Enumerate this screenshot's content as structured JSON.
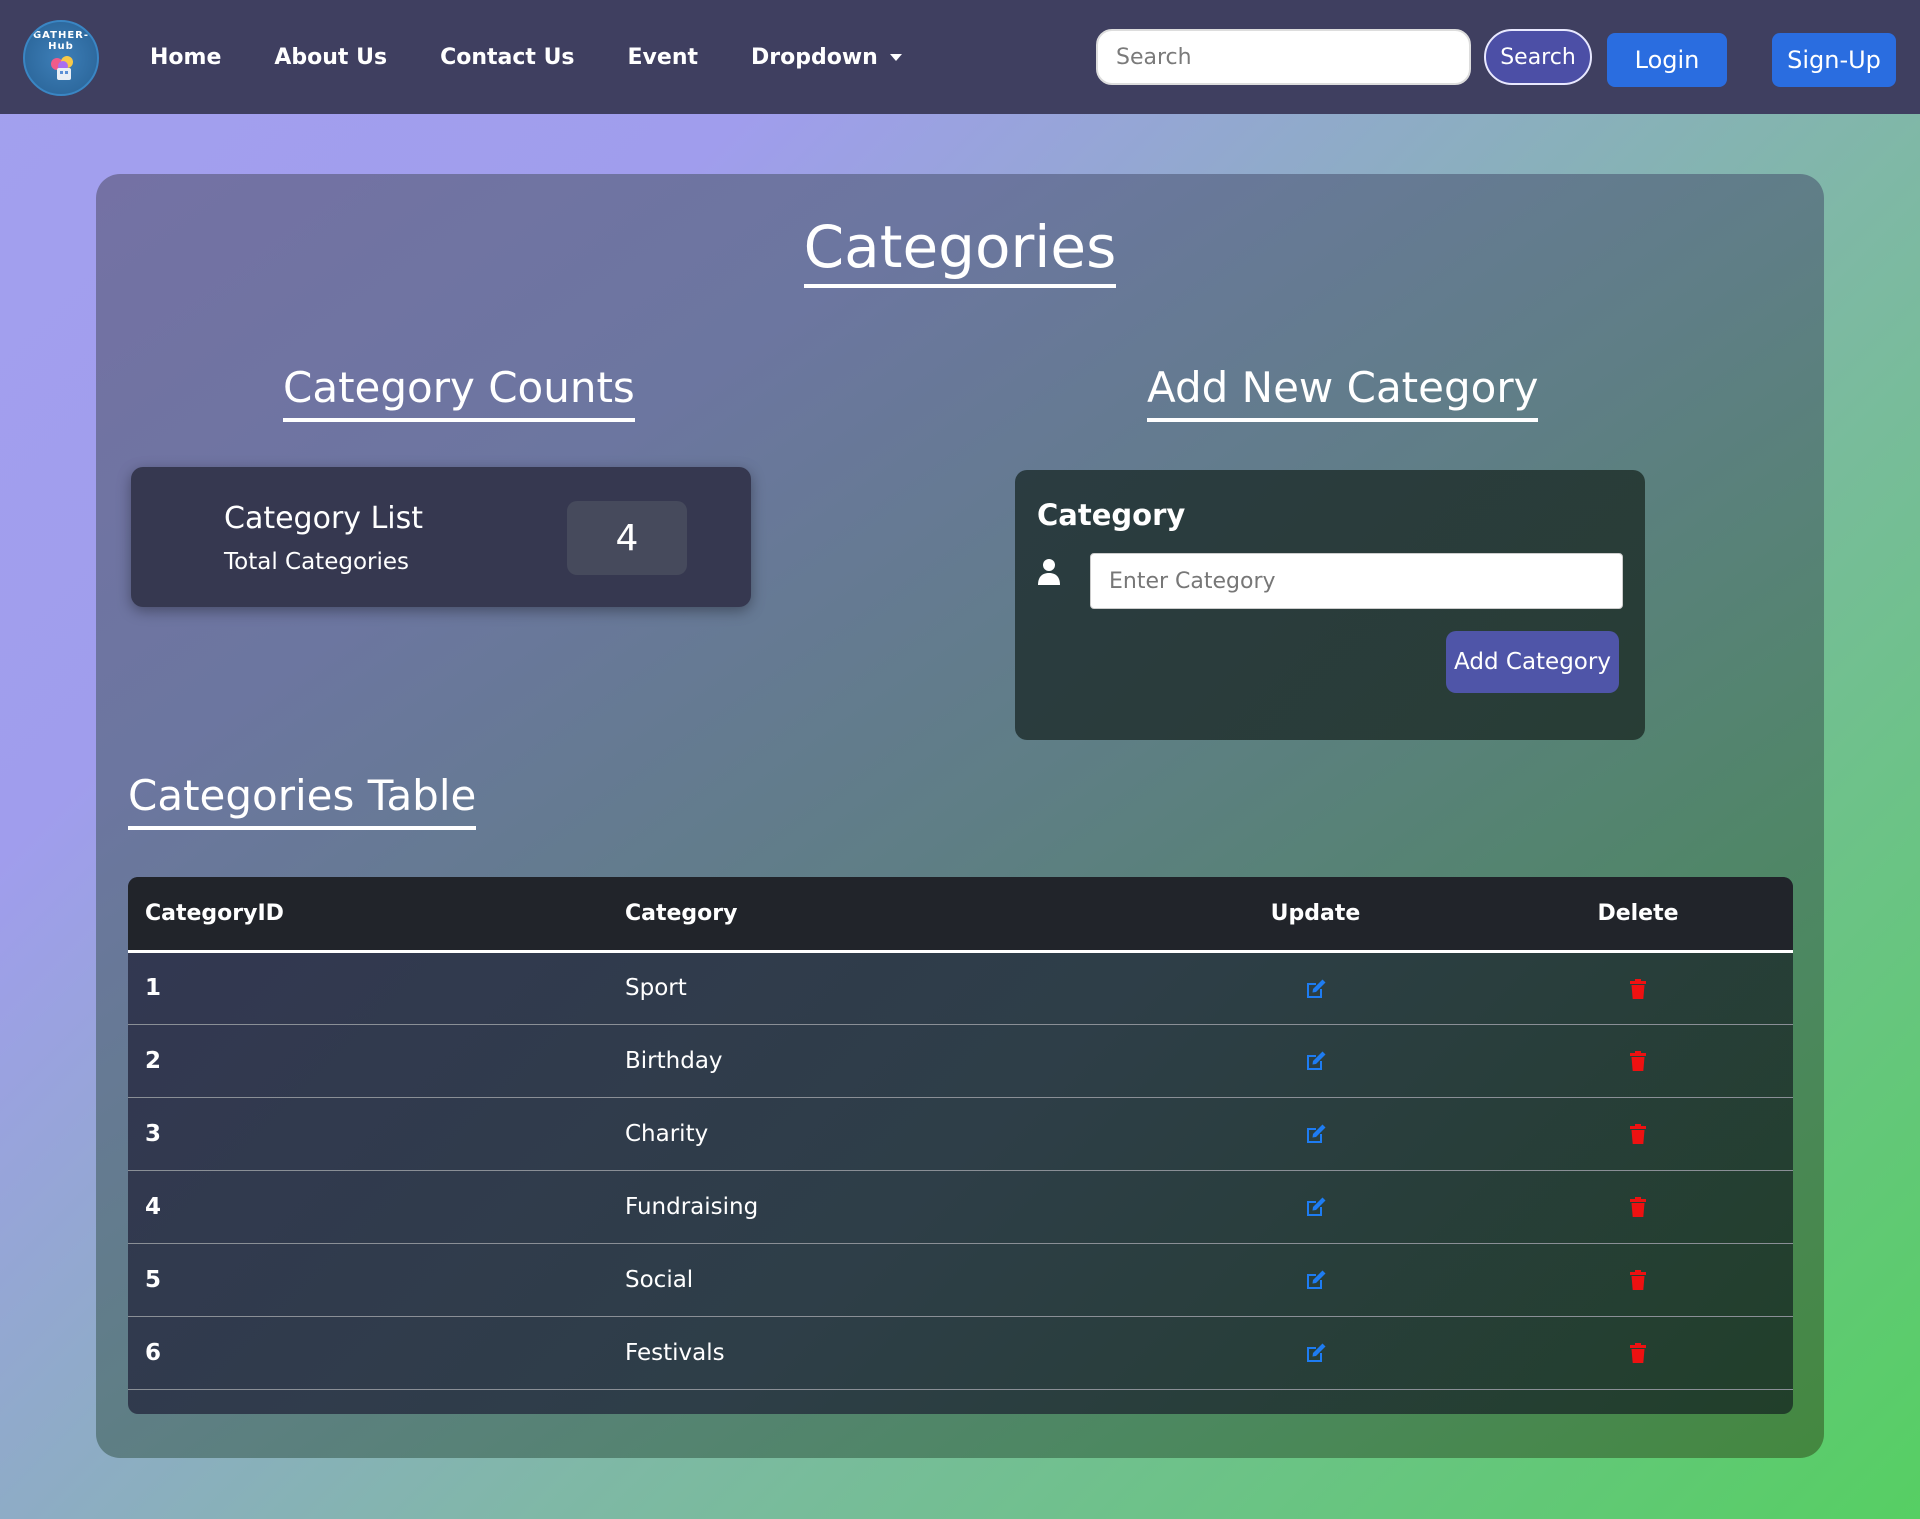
{
  "navbar": {
    "logo_text": "GATHER-Hub",
    "links": [
      "Home",
      "About Us",
      "Contact Us",
      "Event"
    ],
    "dropdown_label": "Dropdown",
    "search_placeholder": "Search",
    "search_button": "Search",
    "login_button": "Login",
    "signup_button": "Sign-Up"
  },
  "page": {
    "title": "Categories"
  },
  "counts": {
    "heading": "Category Counts",
    "card_title": "Category List",
    "card_subtitle": "Total Categories",
    "total": "4"
  },
  "add": {
    "heading": "Add New Category",
    "field_label": "Category",
    "input_placeholder": "Enter Category",
    "button": "Add Category"
  },
  "table": {
    "heading": "Categories Table",
    "columns": [
      "CategoryID",
      "Category",
      "Update",
      "Delete"
    ],
    "rows": [
      {
        "id": "1",
        "category": "Sport"
      },
      {
        "id": "2",
        "category": "Birthday"
      },
      {
        "id": "3",
        "category": "Charity"
      },
      {
        "id": "4",
        "category": "Fundraising"
      },
      {
        "id": "5",
        "category": "Social"
      },
      {
        "id": "6",
        "category": "Festivals"
      }
    ]
  },
  "colors": {
    "navbar": "#3f3f60",
    "accent_button": "#2a6de0",
    "edit_icon": "#1e7cf2",
    "delete_icon": "#ee1111"
  },
  "icons": {
    "user": "user-icon",
    "edit": "edit-icon",
    "delete": "trash-icon",
    "dropdown": "caret-down-icon"
  }
}
